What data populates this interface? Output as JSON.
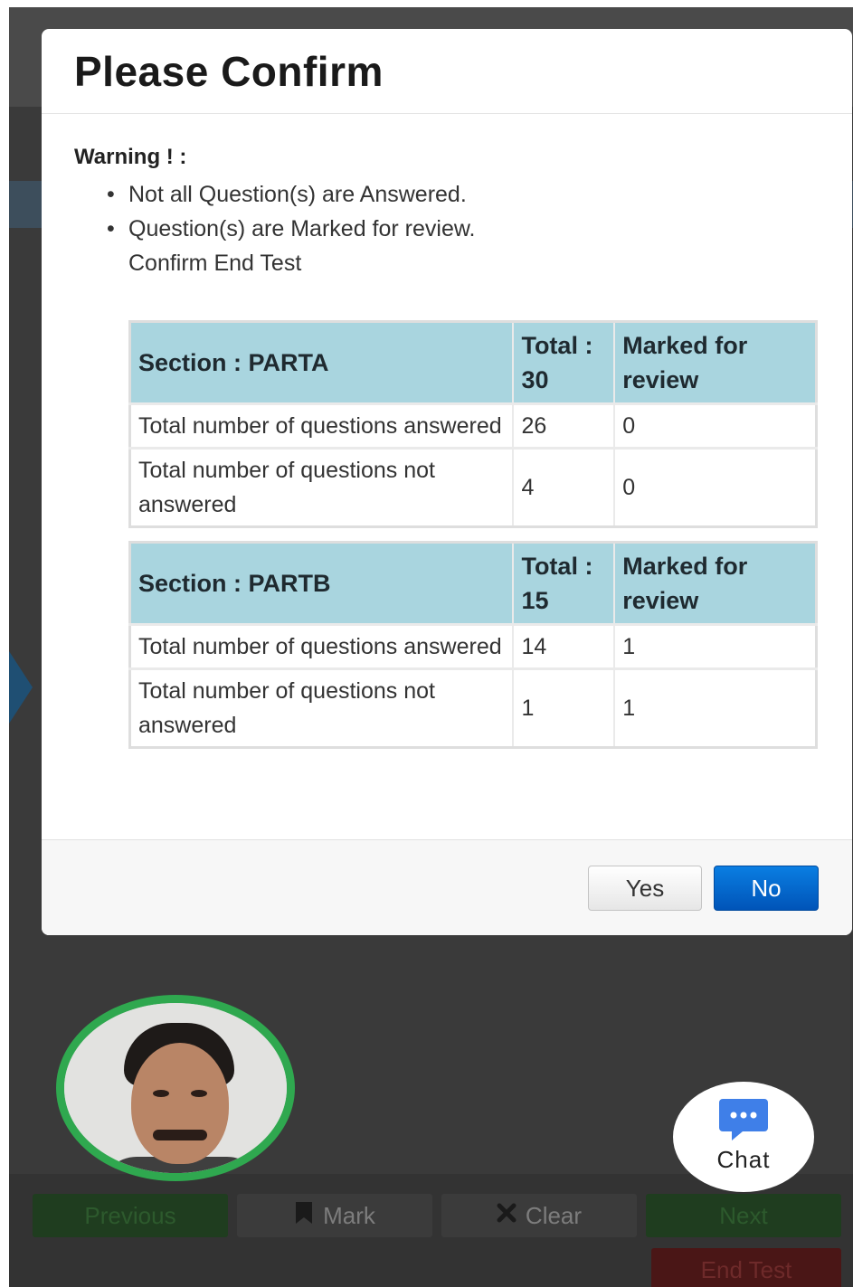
{
  "modal": {
    "title": "Please Confirm",
    "warning_title": "Warning ! :",
    "warnings": [
      "Not all Question(s) are Answered.",
      "Question(s) are Marked for review."
    ],
    "confirm_text": "Confirm End Test",
    "sections": [
      {
        "header": "Section : PARTA",
        "total_label": "Total : 30",
        "marked_label": "Marked for review",
        "rows": [
          {
            "label": "Total number of questions answered",
            "count": "26",
            "marked": "0"
          },
          {
            "label": "Total number of questions not answered",
            "count": "4",
            "marked": "0"
          }
        ]
      },
      {
        "header": "Section : PARTB",
        "total_label": "Total : 15",
        "marked_label": "Marked for review",
        "rows": [
          {
            "label": "Total number of questions answered",
            "count": "14",
            "marked": "1"
          },
          {
            "label": "Total number of questions not answered",
            "count": "1",
            "marked": "1"
          }
        ]
      }
    ],
    "yes_label": "Yes",
    "no_label": "No"
  },
  "bottom_nav": {
    "previous_label": "Previous",
    "mark_label": "Mark",
    "clear_label": "Clear",
    "next_label": "Next",
    "end_test_label": "End Test",
    "mark_icon": "bookmark-icon",
    "clear_icon": "x-icon"
  },
  "chat": {
    "label": "Chat",
    "icon": "chat-bubble-icon"
  },
  "colors": {
    "table_header": "#a9d5df",
    "primary_button": "#0a6ed1",
    "webcam_ring": "#2fa84f",
    "chat_icon": "#3f7fe8"
  }
}
